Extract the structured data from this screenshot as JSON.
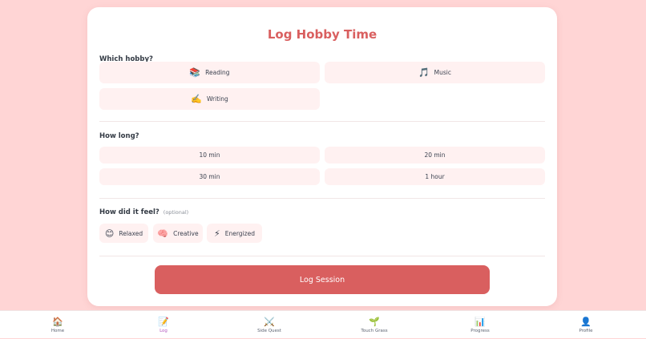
{
  "form": {
    "title": "Log Hobby Time",
    "hobby_label": "Which hobby?",
    "hobbies": [
      {
        "icon": "📚",
        "label": "Reading"
      },
      {
        "icon": "🎵",
        "label": "Music"
      },
      {
        "icon": "✍️",
        "label": "Writing"
      }
    ],
    "duration_label": "How long?",
    "durations": [
      "10 min",
      "20 min",
      "30 min",
      "1 hour"
    ],
    "feel_label": "How did it feel?",
    "feel_optional": "(optional)",
    "feelings": [
      {
        "icon": "😊",
        "label": "Relaxed"
      },
      {
        "icon": "🧠",
        "label": "Creative"
      },
      {
        "icon": "⚡",
        "label": "Energized"
      }
    ],
    "submit_label": "Log Session"
  },
  "nav": {
    "active": "Log",
    "items": [
      {
        "icon": "🏠",
        "label": "Home"
      },
      {
        "icon": "📝",
        "label": "Log"
      },
      {
        "icon": "⚔️",
        "label": "Side Quest"
      },
      {
        "icon": "🌱",
        "label": "Touch Grass"
      },
      {
        "icon": "📊",
        "label": "Progress"
      },
      {
        "icon": "👤",
        "label": "Profile"
      }
    ]
  },
  "colors": {
    "accent": "#d95f5f",
    "background": "#ffd5d5",
    "option_bg": "#fff1f1",
    "active_nav": "#b45ac0"
  }
}
